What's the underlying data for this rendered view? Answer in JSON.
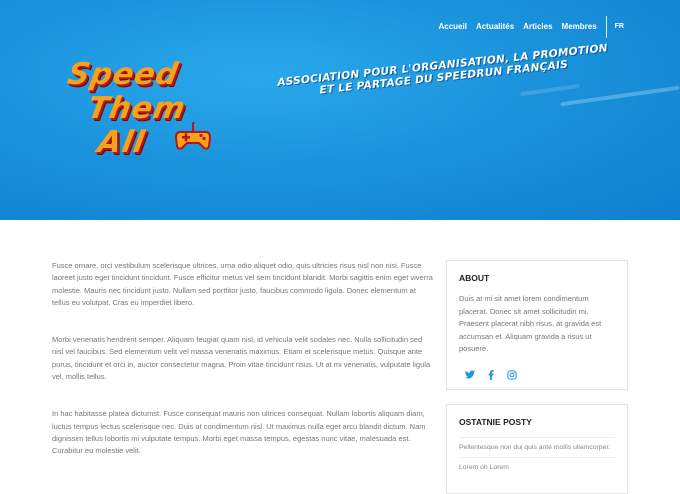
{
  "nav": {
    "items": [
      "Accueil",
      "Actualités",
      "Articles",
      "Membres"
    ],
    "language": "FR"
  },
  "logo": {
    "lines": [
      "Speed",
      "Them",
      "All"
    ]
  },
  "hero": {
    "tagline_line1": "Association pour l'organisation, la promotion",
    "tagline_line2": "et le partage du speedrun français"
  },
  "main": {
    "paragraphs": [
      "Fusce ornare, orci vestibulum scelerisque ultrices, urna odio aliquet odio, quis ultricies risus nisl non nisi. Fusce laoreet justo eget tincidunt tincidunt. Fusce efficitur metus vel sem tincidunt blandit. Morbi sagittis enim eget viverra molestie. Mauris nec tincidunt justo. Nullam sed porttitor justo, faucibus commodo ligula. Donec elementum at tellus eu volutpat. Cras eu imperdiet libero.",
      "Morbi venenatis hendrerit semper. Aliquam feugiat quam nisl, id vehicula velit sodales nec. Nulla sollicitudin sed nisl vel faucibus. Sed elementum velit vel massa venenatis maximus. Etiam et scelerisque metus. Quisque ante purus, tincidunt et orci in, auctor consectetur magna. Proin vitae tincidunt risus. Ut at mi venenatis, vulputate ligula vel, mollis tellus.",
      "In hac habitasse platea dictumst. Fusce consequat mauris non ultrices consequat. Nullam lobortis aliquam diam, luctus tempus lectus scelerisque nec. Duis ut condimentum nisl. Ut maximus nulla eget arcu blandit dictum. Nam dignissim tellus lobortis mi vulputate tempus. Morbi eget massa tempus, egestas nunc vitae, malesuada est. Curabitur eu molestie velit."
    ]
  },
  "sidebar": {
    "about": {
      "title": "ABOUT",
      "text": "Duis at mi sit amet lorem condimentum placerat. Donec sit amet sollicitudin mi. Praesent placerat nibh risus, at gravida est accumsan et. Aliquam gravida a risus ut posuere.",
      "social_icons": [
        "twitter-icon",
        "facebook-icon",
        "instagram-icon"
      ]
    },
    "recent": {
      "title": "OSTATNIE POSTY",
      "items": [
        "Pellentesque non dui quis ante mollis ullamcorper.",
        "Lorem oh Lorem"
      ]
    }
  },
  "colors": {
    "hero_blue": "#1b93dc",
    "logo_orange": "#f7a21b",
    "logo_red": "#b5161c",
    "social_blue": "#1d97d8"
  }
}
